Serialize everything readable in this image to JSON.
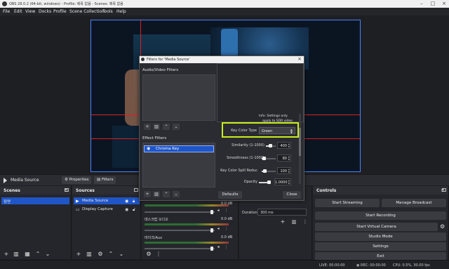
{
  "window": {
    "title": "OBS 28.0.2 (64-bit, windows) - Profile: 제목 없음 - Scenes: 제목 없음"
  },
  "menu": [
    "File",
    "Edit",
    "View",
    "Docks",
    "Profile",
    "Scene Collection",
    "Tools",
    "Help"
  ],
  "source_toolbar": {
    "source_name": "Media Source",
    "properties_label": "Properties",
    "filters_label": "Filters"
  },
  "scenes": {
    "title": "Scenes",
    "items": [
      "장면"
    ]
  },
  "sources": {
    "title": "Sources",
    "items": [
      "Media Source",
      "Display Capture"
    ]
  },
  "mixer": {
    "channels": [
      {
        "name": "",
        "db": "0.0 dB"
      },
      {
        "name": "데스크탑 오디오",
        "db": "0.0 dB"
      },
      {
        "name": "마이크/Aux",
        "db": "0.0 dB"
      }
    ],
    "scale": [
      "-60",
      "-55",
      "-50",
      "-45",
      "-40",
      "-35",
      "-30",
      "-25",
      "-20",
      "-15",
      "-10",
      "-5",
      "0"
    ]
  },
  "transitions": {
    "duration_label": "Duration",
    "duration_value": "300 ms"
  },
  "controls": {
    "title": "Controls",
    "start_streaming": "Start Streaming",
    "manage_broadcast": "Manage Broadcast",
    "start_recording": "Start Recording",
    "start_virtual_camera": "Start Virtual Camera",
    "studio_mode": "Studio Mode",
    "settings": "Settings",
    "exit": "Exit"
  },
  "status": {
    "live": "LIVE: 00:00:00",
    "rec": "REC: 00:00:00",
    "cpu": "CPU: 0.5%, 30.00 fps"
  },
  "filters_dialog": {
    "title": "Filters for 'Media Source'",
    "av_filters_label": "Audio/Video Filters",
    "effect_filters_label": "Effect Filters",
    "effect_items": [
      "Chroma Key"
    ],
    "info_text_1": "Info: Settings only",
    "info_text_2": "apply to SDR video",
    "key_color_type_label": "Key Color Type",
    "key_color_type_value": "Green",
    "properties": [
      {
        "label": "Similarity (1-1000)",
        "value": "400",
        "fraction": 0.4
      },
      {
        "label": "Smoothness (1-1000)",
        "value": "80",
        "fraction": 0.08
      },
      {
        "label": "Key Color Spill Reduc",
        "value": "100",
        "fraction": 0.1
      },
      {
        "label": "Opacity",
        "value": "1.0000",
        "fraction": 1.0
      }
    ],
    "defaults_label": "Defaults",
    "close_label": "Close"
  },
  "colors": {
    "accent_blue": "#1f55c6",
    "highlight": "#c7ef1c",
    "guide_red": "#d92020"
  }
}
